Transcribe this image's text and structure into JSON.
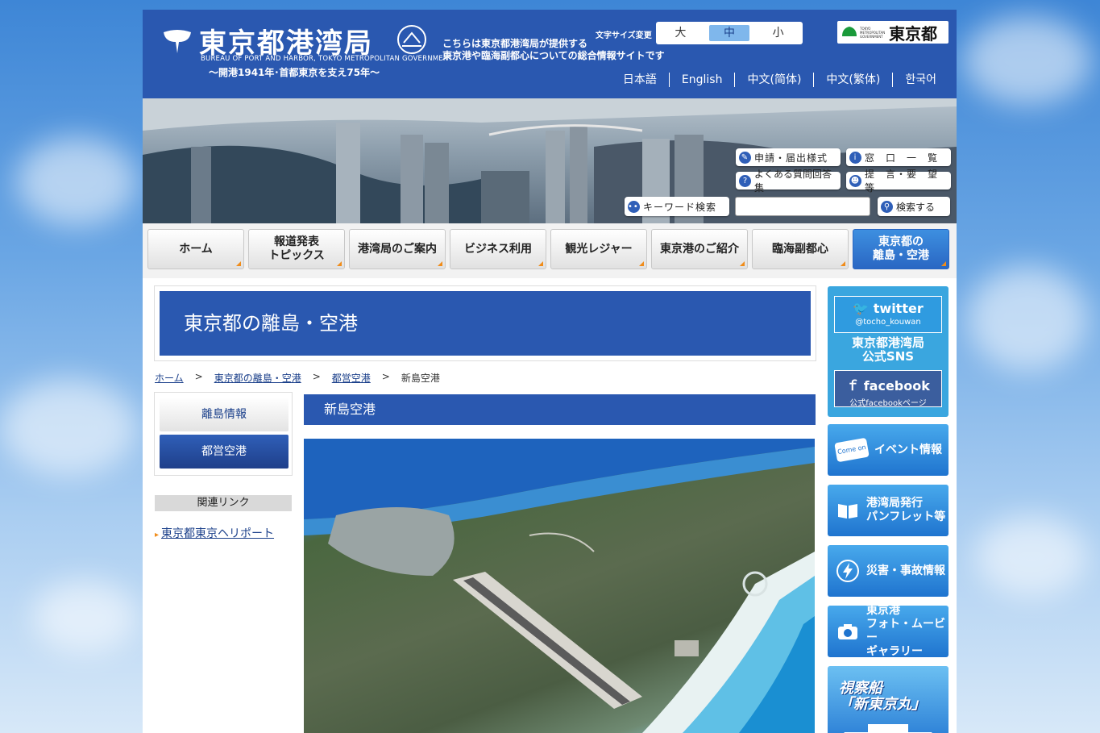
{
  "header": {
    "logo_title": "東京都港湾局",
    "logo_english": "BUREAU OF PORT AND HARBOR, TOKYO METROPOLITAN GOVERNMENT",
    "logo_subtitle": "〜開港1941年･首都東京を支え75年〜",
    "tagline_line1": "こちらは東京都港湾局が提供する",
    "tagline_line2": "東京港や臨海副都心についての総合情報サイトです",
    "font_size_label": "文字サイズ変更",
    "font_sizes": [
      "大",
      "中",
      "小"
    ],
    "font_size_selected": "中",
    "metro_logo_small": "TOKYO METROPOLITAN GOVERNMENT",
    "metro_logo_text": "東京都",
    "languages": [
      "日本語",
      "English",
      "中文(简体)",
      "中文(繁体)",
      "한국어"
    ]
  },
  "hero_links": {
    "forms": "申請・届出様式",
    "windows": "窓　口　一　覧",
    "faq": "よくある質問回答集",
    "proposals": "提　言・要　望　等",
    "keyword_search": "キーワード検索",
    "search_button": "検索する"
  },
  "nav": [
    {
      "label": "ホーム",
      "active": false
    },
    {
      "label": "報道発表\nトピックス",
      "active": false
    },
    {
      "label": "港湾局のご案内",
      "active": false
    },
    {
      "label": "ビジネス利用",
      "active": false
    },
    {
      "label": "観光レジャー",
      "active": false
    },
    {
      "label": "東京港のご紹介",
      "active": false
    },
    {
      "label": "臨海副都心",
      "active": false
    },
    {
      "label": "東京都の\n離島・空港",
      "active": true
    }
  ],
  "page_title": "東京都の離島・空港",
  "breadcrumb": [
    "ホーム",
    "東京都の離島・空港",
    "都営空港",
    "新島空港"
  ],
  "breadcrumb_sep": ">",
  "submenu": [
    {
      "label": "離島情報",
      "active": false
    },
    {
      "label": "都営空港",
      "active": true
    }
  ],
  "related": {
    "title": "関連リンク",
    "links": [
      "東京都東京ヘリポート"
    ]
  },
  "section_title": "新島空港",
  "sidebar": {
    "twitter_label": "twitter",
    "twitter_handle": "@tocho_kouwan",
    "sns_title_line1": "東京都港湾局",
    "sns_title_line2": "公式SNS",
    "facebook_label": "facebook",
    "facebook_sub": "公式facebookページ",
    "event_badge": "Come on",
    "event_label": "イベント情報",
    "pamphlet_label": "港湾局発行\nパンフレット等",
    "disaster_label": "災害・事故情報",
    "gallery_label": "東京港\nフォト・ムービー\nギャラリー",
    "ship_line1": "視察船",
    "ship_line2": "「新東京丸」"
  },
  "colors": {
    "brand_blue": "#2a58b0",
    "accent_orange": "#f08c1a",
    "side_button_blue": "#1f74cf"
  }
}
